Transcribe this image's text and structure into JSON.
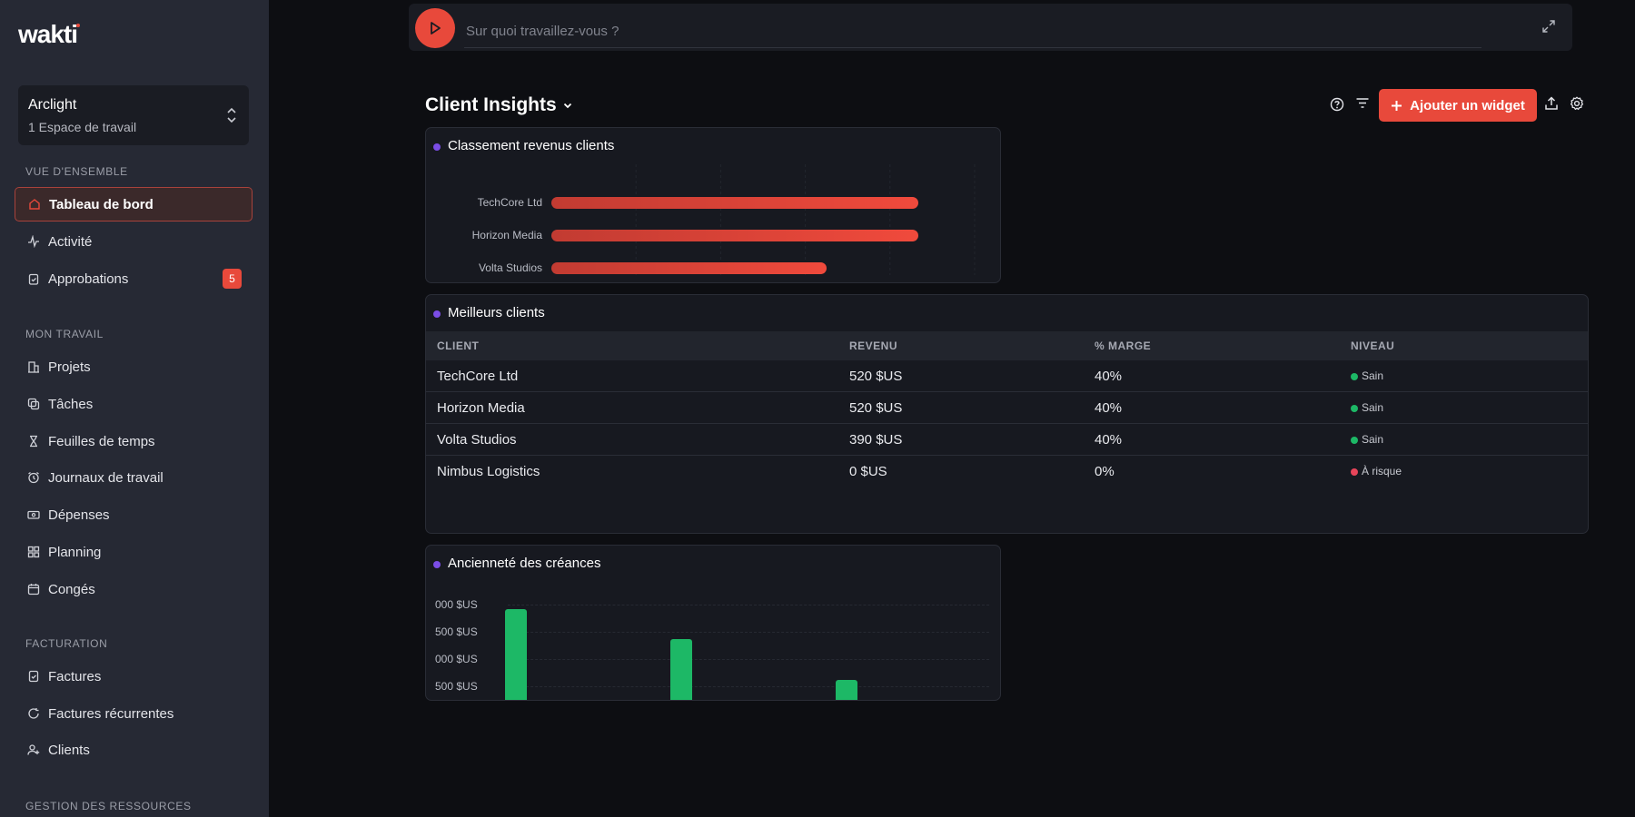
{
  "sidebar": {
    "logo": "wakti",
    "workspace": {
      "name": "Arclight",
      "subtitle": "1 Espace de travail"
    },
    "sections": {
      "overview": "VUE D'ENSEMBLE",
      "my_work": "MON TRAVAIL",
      "billing": "FACTURATION",
      "resources": "GESTION DES RESSOURCES"
    },
    "items": {
      "dashboard": "Tableau de bord",
      "activity": "Activité",
      "approvals": "Approbations",
      "approvals_badge": "5",
      "projects": "Projets",
      "tasks": "Tâches",
      "timesheets": "Feuilles de temps",
      "worklogs": "Journaux de travail",
      "expenses": "Dépenses",
      "planning": "Planning",
      "leaves": "Congés",
      "invoices": "Factures",
      "recurring_invoices": "Factures récurrentes",
      "clients": "Clients"
    }
  },
  "timer": {
    "placeholder": "Sur quoi travaillez-vous ?"
  },
  "header": {
    "title": "Client Insights",
    "add_widget": "Ajouter un widget"
  },
  "widgets": {
    "revenue_ranking": {
      "title": "Classement revenus clients"
    },
    "top_clients": {
      "title": "Meilleurs clients",
      "columns": [
        "CLIENT",
        "REVENU",
        "% MARGE",
        "NIVEAU"
      ],
      "rows": [
        {
          "client": "TechCore Ltd",
          "revenue": "520 $US",
          "margin": "40%",
          "level": "Sain",
          "level_color": "#1db866"
        },
        {
          "client": "Horizon Media",
          "revenue": "520 $US",
          "margin": "40%",
          "level": "Sain",
          "level_color": "#1db866"
        },
        {
          "client": "Volta Studios",
          "revenue": "390 $US",
          "margin": "40%",
          "level": "Sain",
          "level_color": "#1db866"
        },
        {
          "client": "Nimbus Logistics",
          "revenue": "0 $US",
          "margin": "0%",
          "level": "À risque",
          "level_color": "#e8455a"
        }
      ]
    },
    "receivables_aging": {
      "title": "Ancienneté des créances"
    }
  },
  "colors": {
    "accent": "#e8493b",
    "healthy": "#1db866",
    "risk": "#e8455a",
    "bullet": "#7b4de6"
  },
  "chart_data": [
    {
      "type": "bar",
      "orientation": "horizontal",
      "categories": [
        "TechCore Ltd",
        "Horizon Media",
        "Volta Studios"
      ],
      "values": [
        520,
        520,
        390
      ],
      "xlim": [
        0,
        600
      ]
    },
    {
      "type": "bar",
      "tick_labels": [
        "000 $US",
        "500 $US",
        "000 $US",
        "500 $US"
      ],
      "values": [
        3200,
        2150,
        750
      ],
      "ylim": [
        0,
        3500
      ],
      "grid": true
    }
  ]
}
